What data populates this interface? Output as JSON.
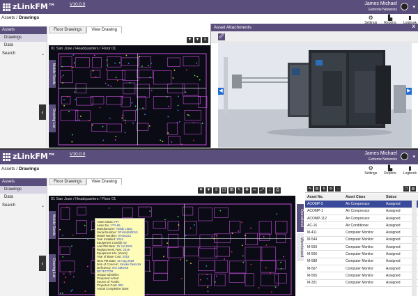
{
  "app": {
    "logo": "zLinkFM™",
    "version": "V10.0.0",
    "user": "James Michael",
    "org": "Extreme Networks"
  },
  "breadcrumb": {
    "parent": "Assets",
    "sep": " / ",
    "current": "Drawings"
  },
  "topnav": [
    {
      "label": "Settings",
      "icon": "gear-icon",
      "glyph": "⚙"
    },
    {
      "label": "Reports",
      "icon": "bar-chart-icon",
      "glyph": "▙"
    },
    {
      "label": "Logbook",
      "icon": "logbook-icon",
      "glyph": "▮"
    }
  ],
  "sidebar": {
    "header": "Assets",
    "items": [
      "Drawings",
      "Data"
    ],
    "search": "Search",
    "chevron": "⌄"
  },
  "tabs": [
    "Floor Drawings",
    "View Drawing"
  ],
  "drawing_title": "01 San Jose / Headquarters / Floor 01",
  "vtabs": {
    "mobile_seeds": "Mobile Seeds",
    "drawing_list": "Drawing List",
    "operational": "Operational",
    "warehoused": "Warehoused"
  },
  "attachments": {
    "title": "Asset Attachments",
    "close": "X",
    "clip": "🖉",
    "prev": "◀",
    "next": "▶"
  },
  "tooltip": [
    [
      "Asset Class:",
      "FFI"
    ],
    [
      "Asset No.:",
      "FFI-56"
    ],
    [
      "Manufacturer:",
      "Teddy Liang"
    ],
    [
      "Serial Number:",
      "DFHU4650010"
    ],
    [
      "Model Number:",
      "SH4U221"
    ],
    [
      "Year Installed:",
      "2016"
    ],
    [
      "Equipment Cost($):",
      "82"
    ],
    [
      "Last PM Date:",
      "15 Jul 2018"
    ],
    [
      "Replacement Year:",
      "2019"
    ],
    [
      "Equipment Life (Years):",
      ""
    ],
    [
      "Year of Base Cost:",
      "2015"
    ],
    [
      "Next PM Date:",
      "15 Aug 2019"
    ],
    [
      "Item of Concern:",
      "Smoke Detector"
    ],
    [
      "Deficiency:",
      "NO SMOKE DETECTOR"
    ],
    [
      "Unique Identifier:",
      ""
    ],
    [
      "Proposed Action:",
      ""
    ],
    [
      "Source of Funds:",
      ""
    ],
    [
      "Projected Cost:",
      "800"
    ],
    [
      "Actual Completion Date:",
      ""
    ]
  ],
  "asset_grid": {
    "columns": [
      "Asset No.",
      "Asset Class",
      "Status"
    ],
    "rows": [
      [
        "ACOMP-5",
        "Air Compressor",
        "Assigned"
      ],
      [
        "ACOMP-1",
        "Air Compressor",
        "Assigned"
      ],
      [
        "ACOMP-112",
        "Air Compressor",
        "Assigned"
      ],
      [
        "AC-16",
        "Air Conditioner",
        "Assigned"
      ],
      [
        "M-411",
        "Computer Monitor",
        "Assigned"
      ],
      [
        "M-544",
        "Computer Monitor",
        "Assigned"
      ],
      [
        "M-559",
        "Computer Monitor",
        "Assigned"
      ],
      [
        "M-566",
        "Computer Monitor",
        "Assigned"
      ],
      [
        "M-588",
        "Computer Monitor",
        "Assigned"
      ],
      [
        "M-567",
        "Computer Monitor",
        "Assigned"
      ],
      [
        "M-565",
        "Computer Monitor",
        "Assigned"
      ],
      [
        "M-321",
        "Computer Monitor",
        "Assigned"
      ]
    ]
  },
  "colors": {
    "header": "#5a4e7c",
    "plan_bg": "#0b0b16",
    "plan_line": "#c14fd6",
    "selected_row": "#3a4a9a"
  }
}
